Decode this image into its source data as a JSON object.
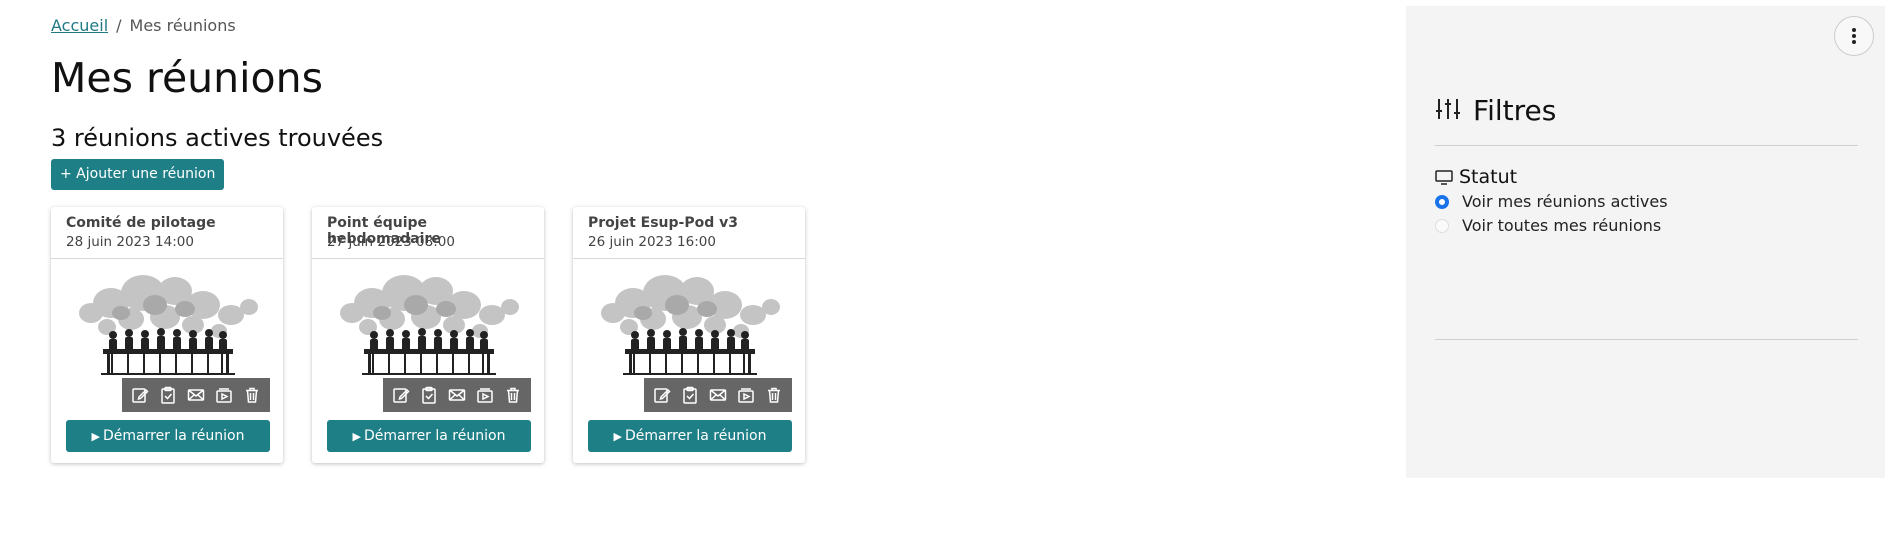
{
  "breadcrumb": {
    "home": "Accueil",
    "separator": "/",
    "current": "Mes réunions"
  },
  "page": {
    "title": "Mes réunions",
    "count_text": "3 réunions actives trouvées",
    "add_button": "+ Ajouter une réunion"
  },
  "meetings": [
    {
      "title": "Comité de pilotage",
      "date": "28 juin 2023 14:00",
      "start_label": "Démarrer la réunion"
    },
    {
      "title": "Point équipe hebdomadaire",
      "date": "27 juin 2023 08:00",
      "start_label": "Démarrer la réunion"
    },
    {
      "title": "Projet Esup-Pod v3",
      "date": "26 juin 2023 16:00",
      "start_label": "Démarrer la réunion"
    }
  ],
  "card_actions": [
    "edit-icon",
    "checklist-icon",
    "mail-icon",
    "video-icon",
    "trash-icon"
  ],
  "filters": {
    "title": "Filtres",
    "status_label": "Statut",
    "options": [
      {
        "label": "Voir mes réunions actives",
        "checked": true
      },
      {
        "label": "Voir toutes mes réunions",
        "checked": false
      }
    ]
  },
  "colors": {
    "accent": "#1f7f87",
    "link": "#1f7a85",
    "sidebar_bg": "#f4f4f4",
    "radio": "#1a73e8"
  }
}
